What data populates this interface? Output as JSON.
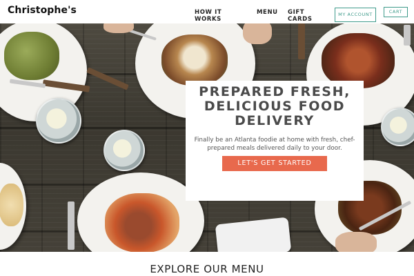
{
  "header": {
    "logo": "Christophe's",
    "nav": [
      {
        "label": "HOW IT WORKS"
      },
      {
        "label": "MENU"
      },
      {
        "label": "GIFT CARDS"
      }
    ],
    "account_label": "MY ACCOUNT",
    "cart_label": "CART",
    "accent_color": "#3d9a8a"
  },
  "hero": {
    "title": "PREPARED FRESH, DELICIOUS FOOD DELIVERY",
    "subtitle": "Finally be an Atlanta foodie at home with fresh, chef-prepared meals delivered daily to your door.",
    "cta_label": "LET'S GET STARTED",
    "cta_color": "#e8694d"
  },
  "menu_section": {
    "title": "EXPLORE OUR MENU"
  }
}
